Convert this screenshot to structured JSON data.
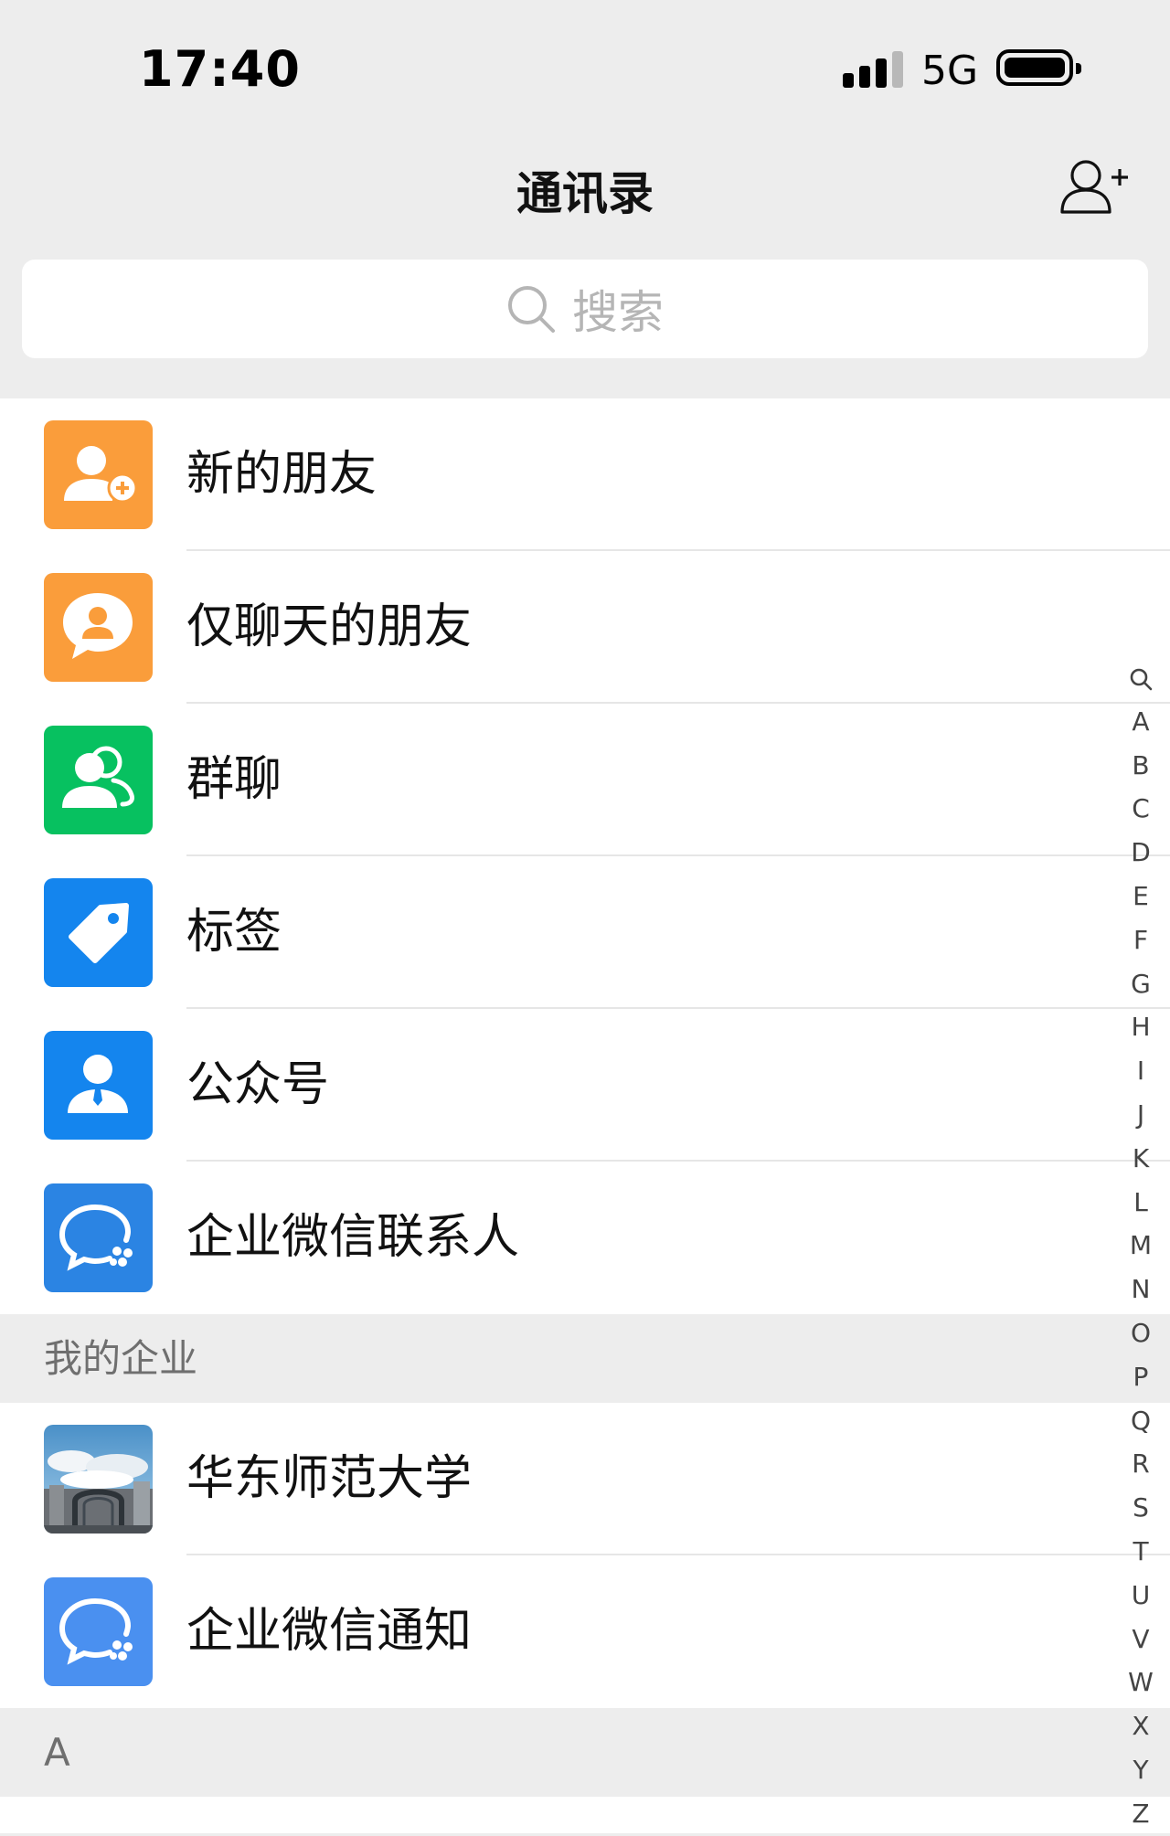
{
  "status_bar": {
    "time": "17:40",
    "network": "5G"
  },
  "nav": {
    "title": "通讯录"
  },
  "search": {
    "placeholder": "搜索"
  },
  "main_items": [
    {
      "label": "新的朋友",
      "icon": "new-friend-icon",
      "color": "#fa9d3b"
    },
    {
      "label": "仅聊天的朋友",
      "icon": "chat-only-friend-icon",
      "color": "#fa9d3b"
    },
    {
      "label": "群聊",
      "icon": "group-chat-icon",
      "color": "#07c160"
    },
    {
      "label": "标签",
      "icon": "tag-icon",
      "color": "#1485ee"
    },
    {
      "label": "公众号",
      "icon": "official-account-icon",
      "color": "#1485ee"
    },
    {
      "label": "企业微信联系人",
      "icon": "wecom-contact-icon",
      "color": "#2b84e3"
    }
  ],
  "enterprise_section": {
    "header": "我的企业",
    "items": [
      {
        "label": "华东师范大学",
        "icon": "university-photo-icon"
      },
      {
        "label": "企业微信通知",
        "icon": "wecom-notification-icon",
        "color": "#4a90f0"
      }
    ]
  },
  "section_a": {
    "header": "A"
  },
  "index_letters": [
    "A",
    "B",
    "C",
    "D",
    "E",
    "F",
    "G",
    "H",
    "I",
    "J",
    "K",
    "L",
    "M",
    "N",
    "O",
    "P",
    "Q",
    "R",
    "S",
    "T",
    "U",
    "V",
    "W",
    "X",
    "Y",
    "Z"
  ]
}
